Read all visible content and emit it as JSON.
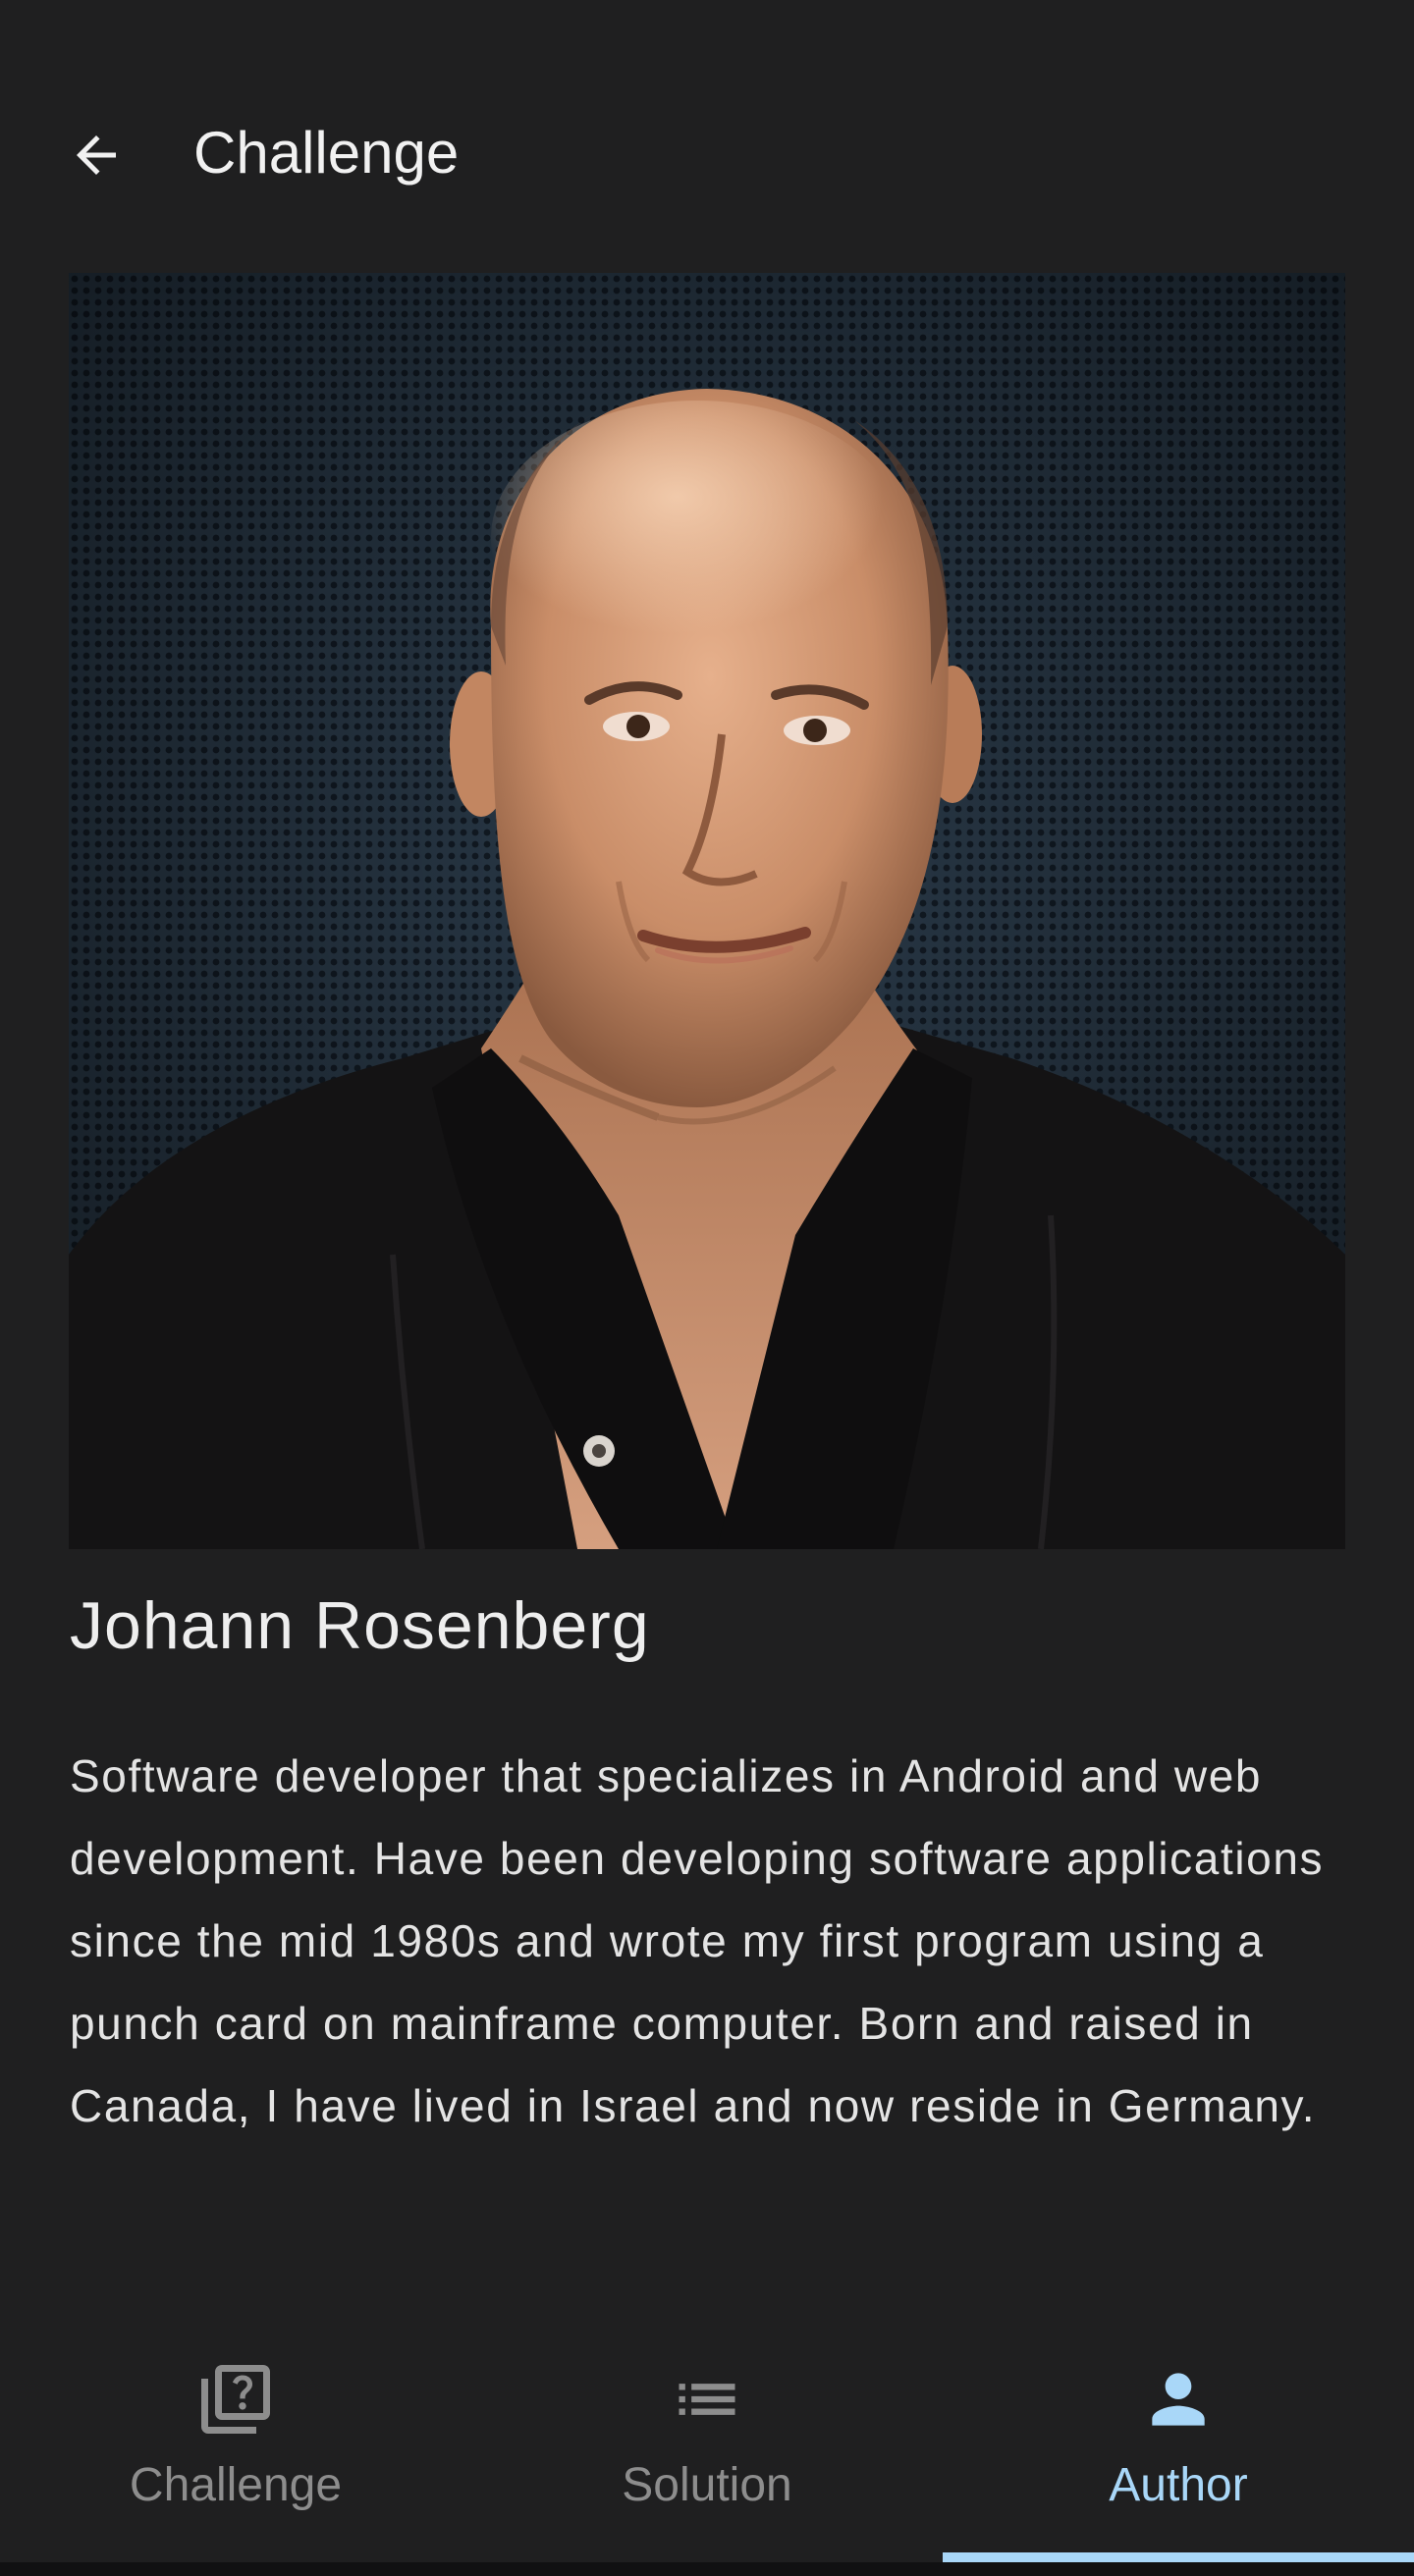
{
  "app_bar": {
    "title": "Challenge",
    "back_icon": "arrow-back-icon"
  },
  "author": {
    "photo": "author-portrait-photo",
    "name": "Johann Rosenberg",
    "bio": "Software developer that specializes in Android and web development. Have been developing software applications since the mid 1980s and wrote my first program using a punch card on mainframe computer. Born and raised in Canada, I have lived in Israel and now reside in Germany."
  },
  "bottom_nav": {
    "items": [
      {
        "label": "Challenge",
        "icon": "quiz-icon",
        "active": false
      },
      {
        "label": "Solution",
        "icon": "list-icon",
        "active": false
      },
      {
        "label": "Author",
        "icon": "person-icon",
        "active": true
      }
    ]
  },
  "colors": {
    "background": "#1f1f20",
    "text_primary": "#e6e6e6",
    "nav_inactive": "#8d8d8d",
    "accent": "#a9d7f8"
  }
}
